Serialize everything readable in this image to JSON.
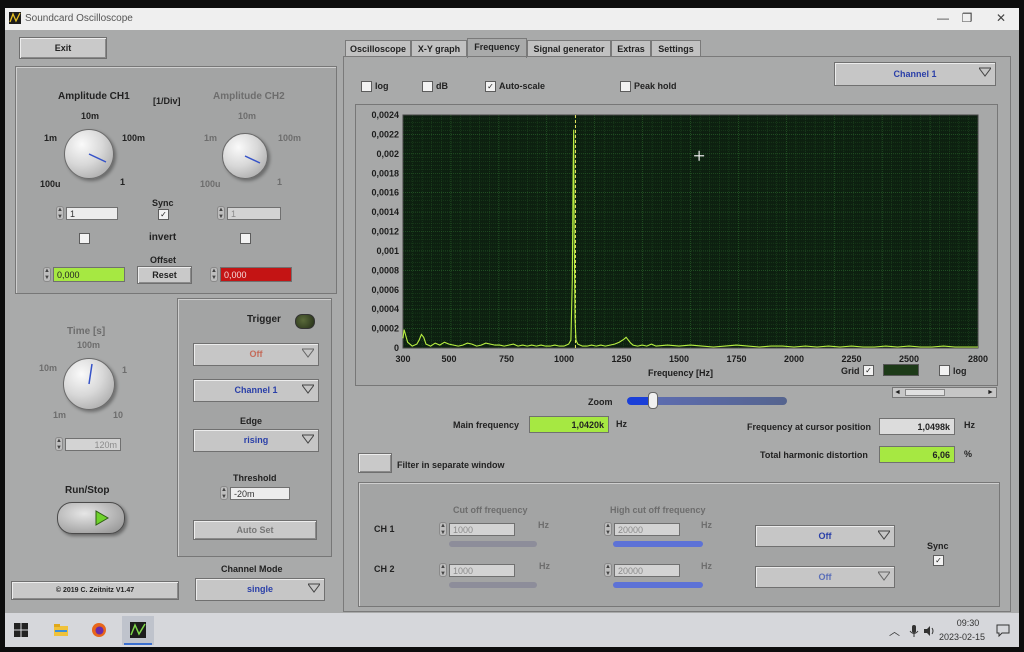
{
  "window": {
    "title": "Soundcard Oscilloscope",
    "minimize": "—",
    "restore": "❐",
    "close": "✕"
  },
  "left": {
    "exit_label": "Exit",
    "amp_ch1_label": "Amplitude CH1",
    "div_label": "[1/Div]",
    "amp_ch2_label": "Amplitude CH2",
    "ch1_scale": {
      "top": "10m",
      "left_top": "1m",
      "right_top": "100m",
      "left_bottom": "100u",
      "right_bottom": "1"
    },
    "ch2_scale": {
      "top": "10m",
      "left_top": "1m",
      "right_top": "100m",
      "left_bottom": "100u",
      "right_bottom": "1"
    },
    "ch1_amp_value": "1",
    "ch2_amp_value": "1",
    "sync_label": "Sync",
    "invert_label": "invert",
    "offset_label": "Offset",
    "reset_label": "Reset",
    "ch1_offset_value": "0,000",
    "ch2_offset_value": "0,000",
    "time_label": "Time [s]",
    "time_scale": {
      "top": "100m",
      "left_top": "10m",
      "right_top": "1",
      "left_bottom": "1m",
      "right_bottom": "10"
    },
    "time_value": "120m",
    "runstop_label": "Run/Stop",
    "copyright": "© 2019  C. Zeitnitz V1.47",
    "trigger_label": "Trigger",
    "trigger_mode": "Off",
    "trigger_channel": "Channel 1",
    "edge_label": "Edge",
    "edge_value": "rising",
    "threshold_label": "Threshold",
    "threshold_value": "-20m",
    "autoset_label": "Auto Set",
    "channel_mode_label": "Channel Mode",
    "channel_mode_value": "single"
  },
  "tabs": [
    {
      "label": "Oscilloscope"
    },
    {
      "label": "X-Y graph"
    },
    {
      "label": "Frequency"
    },
    {
      "label": "Signal generator"
    },
    {
      "label": "Extras"
    },
    {
      "label": "Settings"
    }
  ],
  "freq": {
    "log_label": "log",
    "db_label": "dB",
    "autoscale_label": "Auto-scale",
    "peakhold_label": "Peak hold",
    "channel_select": "Channel 1",
    "grid_label": "Grid",
    "log2_label": "log",
    "zoom_label": "Zoom",
    "main_freq_label": "Main frequency",
    "main_freq_value": "1,0420k",
    "main_freq_unit": "Hz",
    "cursor_freq_label": "Frequency at cursor position",
    "cursor_freq_value": "1,0498k",
    "cursor_freq_unit": "Hz",
    "thd_label": "Total harmonic distortion",
    "thd_value": "6,06",
    "thd_unit": "%",
    "filter_label": "Filter in separate window",
    "cutoff_label": "Cut off frequency",
    "highcut_label": "High cut off frequency",
    "ch1_label": "CH 1",
    "ch2_label": "CH 2",
    "ch1_cutoff": "1000",
    "ch2_cutoff": "1000",
    "ch1_highcut": "20000",
    "ch2_highcut": "20000",
    "hz": "Hz",
    "ch1_filter": "Off",
    "ch2_filter": "Off",
    "sync_label": "Sync"
  },
  "colors": {
    "plot_bg": "#0d2010",
    "grid": "#2d6b2d",
    "trace": "#b8ef42",
    "cursor": "#e8e860",
    "green_field": "#a6e842",
    "red_field": "#c41414"
  },
  "chart_data": {
    "type": "line",
    "xlabel": "Frequency [Hz]",
    "ylabel": "",
    "xlim": [
      300,
      2800
    ],
    "ylim": [
      0,
      0.0024
    ],
    "xticks": [
      "300",
      "500",
      "750",
      "1000",
      "1250",
      "1500",
      "1750",
      "2000",
      "2250",
      "2500",
      "2800"
    ],
    "yticks": [
      "0",
      "0,0002",
      "0,0004",
      "0,0006",
      "0,0008",
      "0,001",
      "0,0012",
      "0,0014",
      "0,0016",
      "0,0018",
      "0,002",
      "0,0022",
      "0,0024"
    ],
    "series": [
      {
        "x": [
          300,
          305,
          320,
          340,
          360,
          370,
          380,
          390,
          400,
          420,
          440,
          460,
          480,
          500,
          520,
          540,
          560,
          580,
          600,
          620,
          640,
          660,
          680,
          700,
          720,
          740,
          760,
          780,
          800,
          820,
          840,
          860,
          880,
          900,
          920,
          940,
          960,
          980,
          1000,
          1010,
          1020,
          1030,
          1036,
          1040,
          1042,
          1044,
          1048,
          1052,
          1060,
          1070,
          1080,
          1100,
          1120,
          1140,
          1160,
          1180,
          1200,
          1220,
          1240,
          1260,
          1270,
          1280,
          1290,
          1300,
          1320,
          1340,
          1360,
          1380,
          1400,
          1450,
          1500,
          1550,
          1600,
          1650,
          1700,
          1750,
          1800,
          1850,
          1900,
          1950,
          2000,
          2050,
          2100,
          2150,
          2200,
          2250,
          2300,
          2350,
          2400,
          2450,
          2500,
          2550,
          2600,
          2650,
          2700,
          2750,
          2800
        ],
        "values": [
          0.0001,
          0.00019,
          6e-05,
          2e-05,
          4e-05,
          8e-05,
          0.00014,
          0.00011,
          4e-05,
          2e-05,
          5e-05,
          3e-05,
          6e-05,
          4e-05,
          3e-05,
          2e-05,
          3e-05,
          5e-05,
          4e-05,
          2e-05,
          3e-05,
          5e-05,
          4e-05,
          3e-05,
          3e-05,
          2e-05,
          3e-05,
          4e-05,
          2e-05,
          3e-05,
          2e-05,
          3e-05,
          2e-05,
          3e-05,
          2e-05,
          2e-05,
          3e-05,
          2e-05,
          2e-05,
          3e-05,
          4e-05,
          8e-05,
          0.0007,
          0.0019,
          0.00225,
          0.0013,
          0.0003,
          8e-05,
          4e-05,
          3e-05,
          2e-05,
          2e-05,
          3e-05,
          2e-05,
          3e-05,
          2e-05,
          3e-05,
          4e-05,
          6e-05,
          9e-05,
          0.00011,
          8e-05,
          5e-05,
          3e-05,
          2e-05,
          3e-05,
          2e-05,
          4e-05,
          2e-05,
          3e-05,
          2e-05,
          3e-05,
          2e-05,
          1e-05,
          2e-05,
          3e-05,
          2e-05,
          1e-05,
          2e-05,
          2e-05,
          1e-05,
          2e-05,
          1e-05,
          2e-05,
          1e-05,
          2e-05,
          1e-05,
          1e-05,
          2e-05,
          1e-05,
          2e-05,
          1e-05,
          1e-05,
          2e-05,
          1e-05,
          1e-05,
          1e-05
        ]
      }
    ],
    "cursor_x": 1049.8,
    "grid": true
  },
  "taskbar": {
    "time": "09:30",
    "date": "2023-02-15"
  }
}
